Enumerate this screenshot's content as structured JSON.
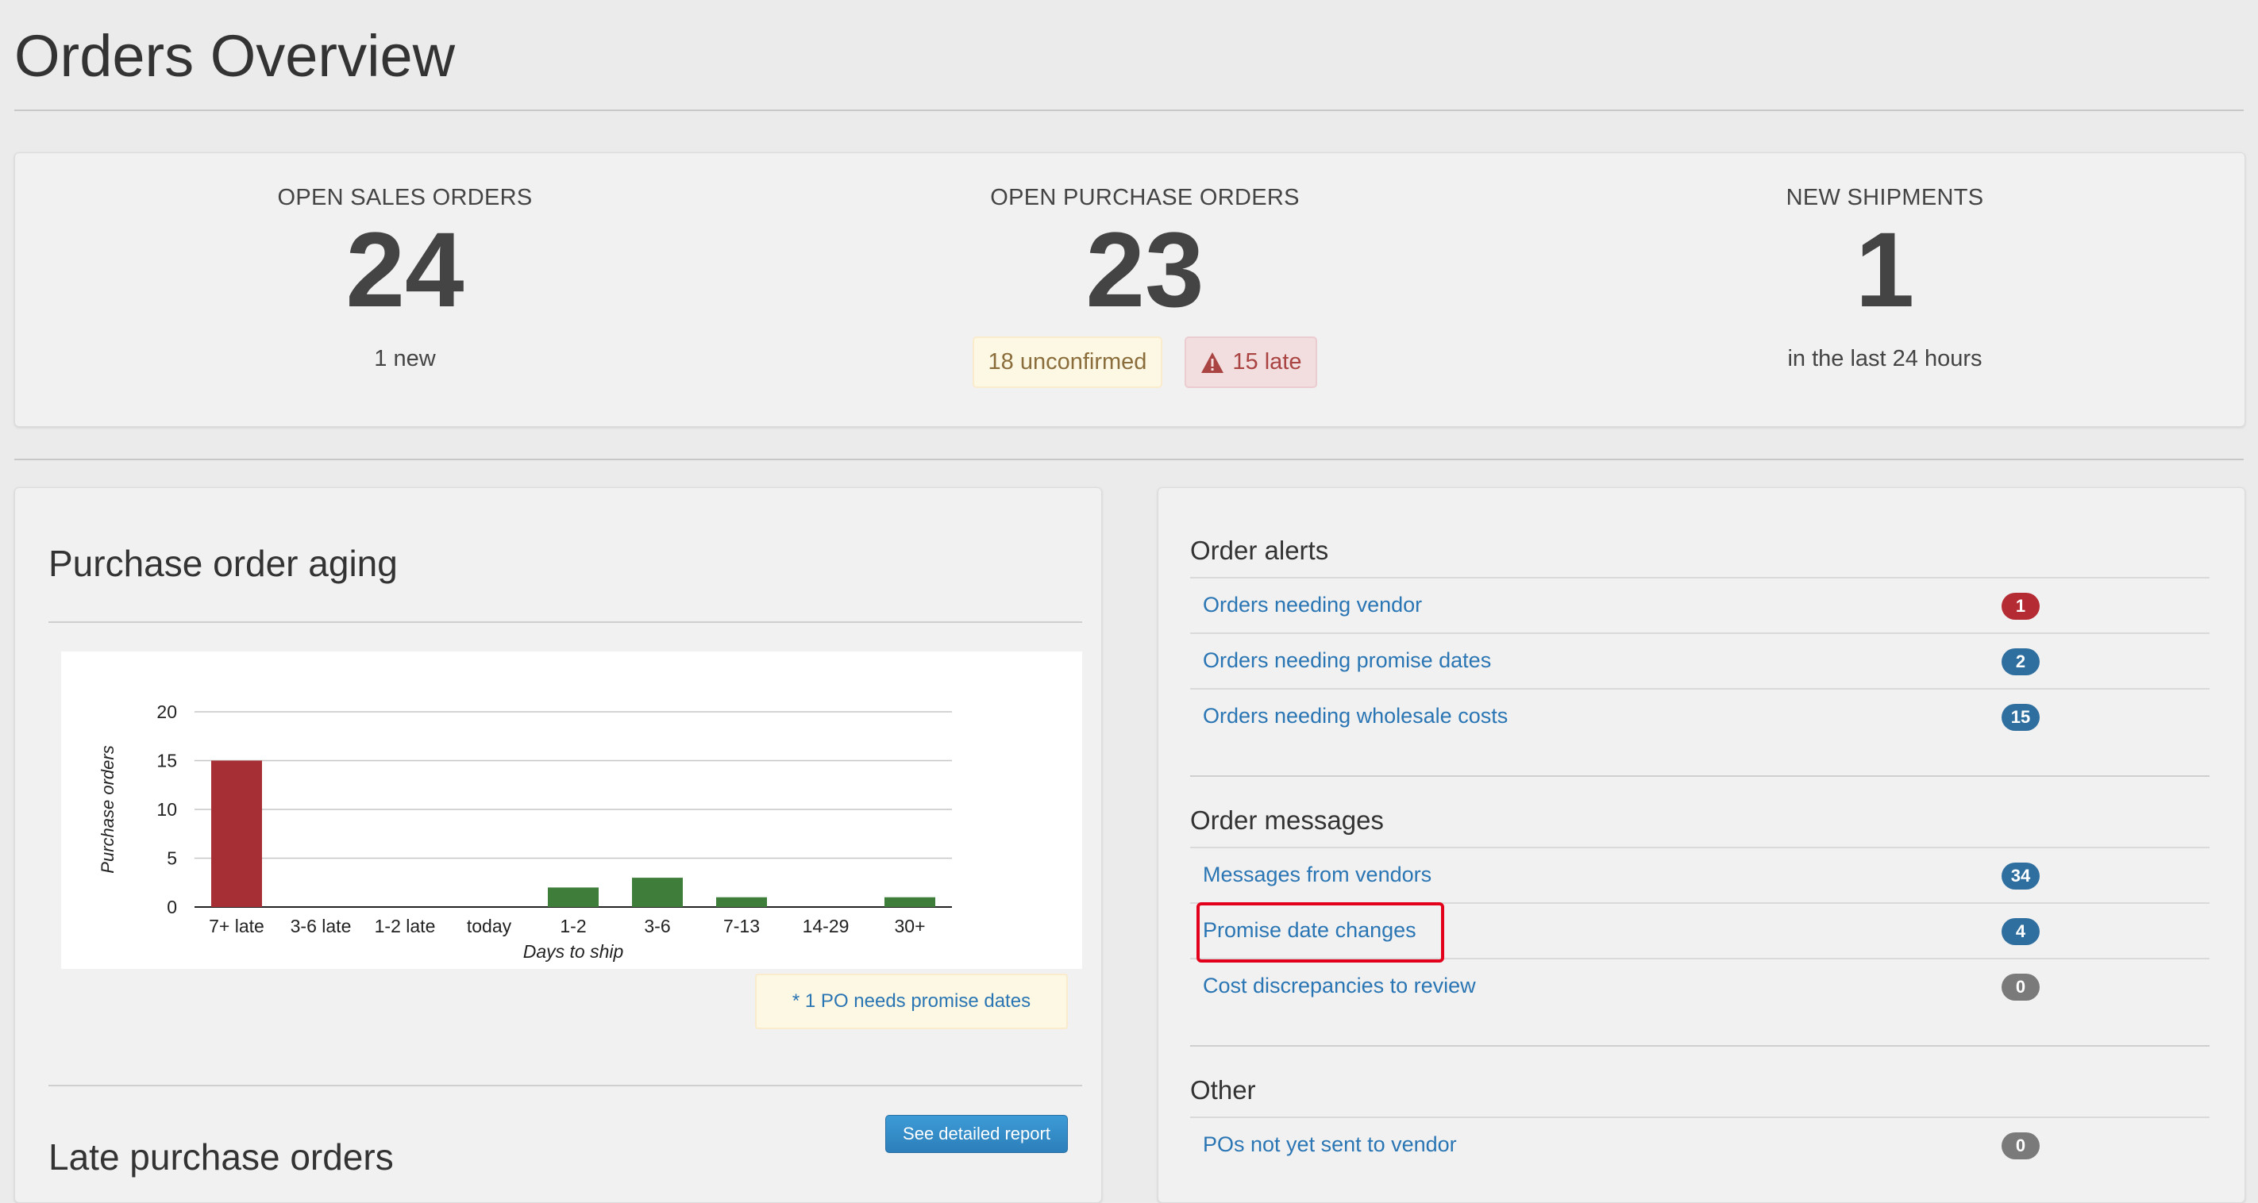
{
  "page": {
    "title": "Orders Overview"
  },
  "stats": {
    "open_sales": {
      "label": "OPEN SALES ORDERS",
      "value": "24",
      "sub": "1 new"
    },
    "open_purchase": {
      "label": "OPEN PURCHASE ORDERS",
      "value": "23",
      "unconfirmed": "18 unconfirmed",
      "late": "15 late"
    },
    "shipments": {
      "label": "NEW SHIPMENTS",
      "value": "1",
      "sub": "in the last 24 hours"
    }
  },
  "aging": {
    "title": "Purchase order aging",
    "note": "* 1 PO needs promise dates",
    "report_button": "See detailed report"
  },
  "late": {
    "title": "Late purchase orders"
  },
  "chart_data": {
    "type": "bar",
    "categories": [
      "7+ late",
      "3-6 late",
      "1-2 late",
      "today",
      "1-2",
      "3-6",
      "7-13",
      "14-29",
      "30+"
    ],
    "values": [
      15,
      0,
      0,
      0,
      2,
      3,
      1,
      0,
      1
    ],
    "bar_colors": [
      "#a52f34",
      "#a52f34",
      "#a52f34",
      "#a52f34",
      "#3e7d3a",
      "#3e7d3a",
      "#3e7d3a",
      "#3e7d3a",
      "#3e7d3a"
    ],
    "xlabel": "Days to ship",
    "ylabel": "Purchase orders",
    "ylim": [
      0,
      20
    ],
    "yticks": [
      0,
      5,
      10,
      15,
      20
    ],
    "grid": true,
    "legend": false
  },
  "alerts": {
    "title": "Order alerts",
    "items": [
      {
        "label": "Orders needing vendor",
        "count": "1",
        "color": "#b52b33"
      },
      {
        "label": "Orders needing promise dates",
        "count": "2",
        "color": "#2f6f9f"
      },
      {
        "label": "Orders needing wholesale costs",
        "count": "15",
        "color": "#2f6f9f"
      }
    ]
  },
  "messages": {
    "title": "Order messages",
    "items": [
      {
        "label": "Messages from vendors",
        "count": "34",
        "color": "#2f6f9f"
      },
      {
        "label": "Promise date changes",
        "count": "4",
        "color": "#2f6f9f"
      },
      {
        "label": "Cost discrepancies to review",
        "count": "0",
        "color": "#7a7a7a"
      }
    ]
  },
  "other": {
    "title": "Other",
    "items": [
      {
        "label": "POs not yet sent to vendor",
        "count": "0",
        "color": "#7a7a7a"
      }
    ]
  }
}
